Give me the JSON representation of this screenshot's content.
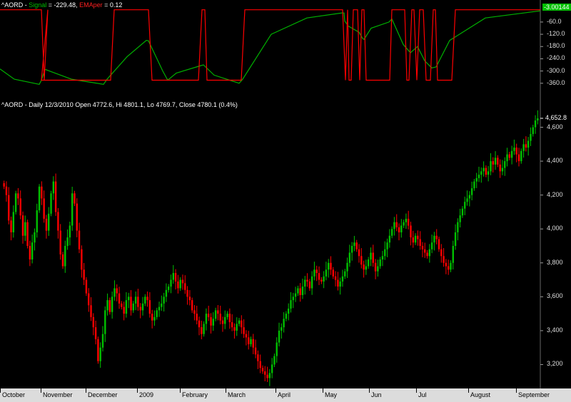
{
  "indicator_header": {
    "symbol": "^AORD",
    "sep1": " - ",
    "signal_label": "Signal",
    "signal_value": " = -229.48, ",
    "emaper_label": "EMAper",
    "emaper_value": " = 0.12"
  },
  "price_header": "^AORD - Daily 12/3/2010 Open 4772.6, Hi 4801.1, Lo 4769.7, Close 4780.1 (0.4%)",
  "colors": {
    "signal": "#00b000",
    "emaper": "#ff0000",
    "up": "#00c000",
    "down": "#ff0000",
    "last_box": "#00c000"
  },
  "chart_data": [
    {
      "type": "line",
      "title": "^AORD - Signal / EMAper",
      "ylim": [
        -420,
        20
      ],
      "y_ticks": [
        "-60.0",
        "-120.0",
        "-180.0",
        "-240.0",
        "-300.0",
        "-360.0"
      ],
      "y_tick_values": [
        -60,
        -120,
        -180,
        -240,
        -300,
        -360
      ],
      "last_value_label": "-3.00144",
      "series": [
        {
          "name": "Signal",
          "points": [
            [
              0,
              -290
            ],
            [
              20,
              -340
            ],
            [
              55,
              -365
            ],
            [
              58,
              -345
            ],
            [
              63,
              -292
            ],
            [
              100,
              -340
            ],
            [
              145,
              -365
            ],
            [
              150,
              -340
            ],
            [
              178,
              -230
            ],
            [
              205,
              -150
            ],
            [
              208,
              -152
            ],
            [
              228,
              -300
            ],
            [
              235,
              -345
            ],
            [
              247,
              -310
            ],
            [
              280,
              -275
            ],
            [
              285,
              -270
            ],
            [
              300,
              -320
            ],
            [
              335,
              -360
            ],
            [
              340,
              -340
            ],
            [
              380,
              -120
            ],
            [
              430,
              -40
            ],
            [
              480,
              -15
            ],
            [
              482,
              -16
            ],
            [
              483,
              -55
            ],
            [
              488,
              -80
            ],
            [
              503,
              -110
            ],
            [
              508,
              -140
            ],
            [
              510,
              -145
            ],
            [
              520,
              -90
            ],
            [
              545,
              -60
            ],
            [
              549,
              -45
            ],
            [
              565,
              -170
            ],
            [
              575,
              -210
            ],
            [
              585,
              -180
            ],
            [
              595,
              -250
            ],
            [
              605,
              -285
            ],
            [
              611,
              -280
            ],
            [
              630,
              -150
            ],
            [
              680,
              -40
            ],
            [
              757,
              -5
            ]
          ]
        },
        {
          "name": "EMAper",
          "points": [
            [
              0,
              0
            ],
            [
              58,
              0
            ],
            [
              62,
              -345
            ],
            [
              67,
              0
            ],
            [
              58,
              -345
            ],
            [
              155,
              -345
            ],
            [
              160,
              0
            ],
            [
              208,
              0
            ],
            [
              213,
              -345
            ],
            [
              278,
              -345
            ],
            [
              283,
              0
            ],
            [
              287,
              0
            ],
            [
              290,
              -345
            ],
            [
              338,
              -345
            ],
            [
              343,
              0
            ],
            [
              480,
              0
            ],
            [
              484,
              -345
            ],
            [
              487,
              0
            ],
            [
              489,
              -345
            ],
            [
              492,
              -345
            ],
            [
              495,
              0
            ],
            [
              501,
              0
            ],
            [
              504,
              -345
            ],
            [
              507,
              0
            ],
            [
              510,
              0
            ],
            [
              513,
              -345
            ],
            [
              546,
              -345
            ],
            [
              549,
              0
            ],
            [
              567,
              0
            ],
            [
              570,
              -345
            ],
            [
              573,
              -345
            ],
            [
              577,
              0
            ],
            [
              580,
              0
            ],
            [
              584,
              -345
            ],
            [
              588,
              0
            ],
            [
              593,
              0
            ],
            [
              597,
              -345
            ],
            [
              603,
              -345
            ],
            [
              607,
              0
            ],
            [
              610,
              0
            ],
            [
              613,
              -345
            ],
            [
              633,
              -345
            ],
            [
              638,
              0
            ],
            [
              757,
              0
            ]
          ]
        }
      ]
    },
    {
      "type": "candlestick",
      "title": "^AORD - Daily 12/3/2010 Open 4772.6, Hi 4801.1, Lo 4769.7, Close 4780.1 (0.4%)",
      "ylim": [
        3080,
        4720
      ],
      "y_ticks": [
        "4,600",
        "4,400",
        "4,200",
        "4,000",
        "3,800",
        "3,600",
        "3,400",
        "3,200"
      ],
      "y_tick_values": [
        4600,
        4400,
        4200,
        4000,
        3800,
        3600,
        3400,
        3200
      ],
      "last_value_label": "4,652.8",
      "x_month_labels": [
        "October",
        "November",
        "December",
        "2009",
        "February",
        "March",
        "April",
        "May",
        "Jun",
        "Jul",
        "August",
        "September"
      ],
      "closes": [
        4250,
        4200,
        4050,
        3980,
        4100,
        4210,
        4180,
        4080,
        3960,
        4040,
        3900,
        3820,
        3920,
        3980,
        4110,
        4250,
        4180,
        4060,
        3990,
        4090,
        4210,
        4280,
        4100,
        3990,
        3850,
        3780,
        3900,
        3950,
        4020,
        4210,
        4150,
        3990,
        3880,
        3760,
        3700,
        3620,
        3550,
        3480,
        3420,
        3350,
        3220,
        3300,
        3380,
        3520,
        3580,
        3510,
        3600,
        3650,
        3620,
        3560,
        3540,
        3500,
        3580,
        3600,
        3520,
        3560,
        3600,
        3540,
        3520,
        3560,
        3600,
        3580,
        3500,
        3460,
        3480,
        3520,
        3540,
        3560,
        3600,
        3640,
        3660,
        3700,
        3740,
        3690,
        3650,
        3700,
        3680,
        3640,
        3600,
        3580,
        3520,
        3500,
        3460,
        3420,
        3380,
        3440,
        3500,
        3480,
        3430,
        3470,
        3520,
        3500,
        3460,
        3440,
        3480,
        3500,
        3450,
        3420,
        3400,
        3440,
        3460,
        3420,
        3380,
        3360,
        3320,
        3350,
        3300,
        3260,
        3220,
        3180,
        3160,
        3140,
        3120,
        3150,
        3200,
        3250,
        3330,
        3400,
        3420,
        3470,
        3500,
        3530,
        3580,
        3600,
        3620,
        3650,
        3610,
        3660,
        3700,
        3690,
        3650,
        3720,
        3760,
        3740,
        3700,
        3690,
        3720,
        3760,
        3800,
        3760,
        3720,
        3700,
        3660,
        3690,
        3720,
        3750,
        3800,
        3860,
        3900,
        3920,
        3880,
        3840,
        3790,
        3760,
        3780,
        3820,
        3860,
        3800,
        3750,
        3780,
        3820,
        3840,
        3880,
        3920,
        3960,
        4000,
        4040,
        4010,
        3980,
        4020,
        4040,
        4060,
        4020,
        3950,
        3920,
        3960,
        3940,
        3900,
        3880,
        3860,
        3840,
        3880,
        3920,
        3960,
        3940,
        3880,
        3840,
        3800,
        3780,
        3760,
        3800,
        3900,
        3980,
        4040,
        4080,
        4120,
        4160,
        4180,
        4200,
        4240,
        4280,
        4300,
        4320,
        4340,
        4360,
        4320,
        4340,
        4400,
        4380,
        4420,
        4380,
        4340,
        4360,
        4400,
        4440,
        4420,
        4460,
        4480,
        4440,
        4400,
        4460,
        4500,
        4480,
        4520,
        4560,
        4600,
        4640,
        4652.8
      ]
    }
  ]
}
